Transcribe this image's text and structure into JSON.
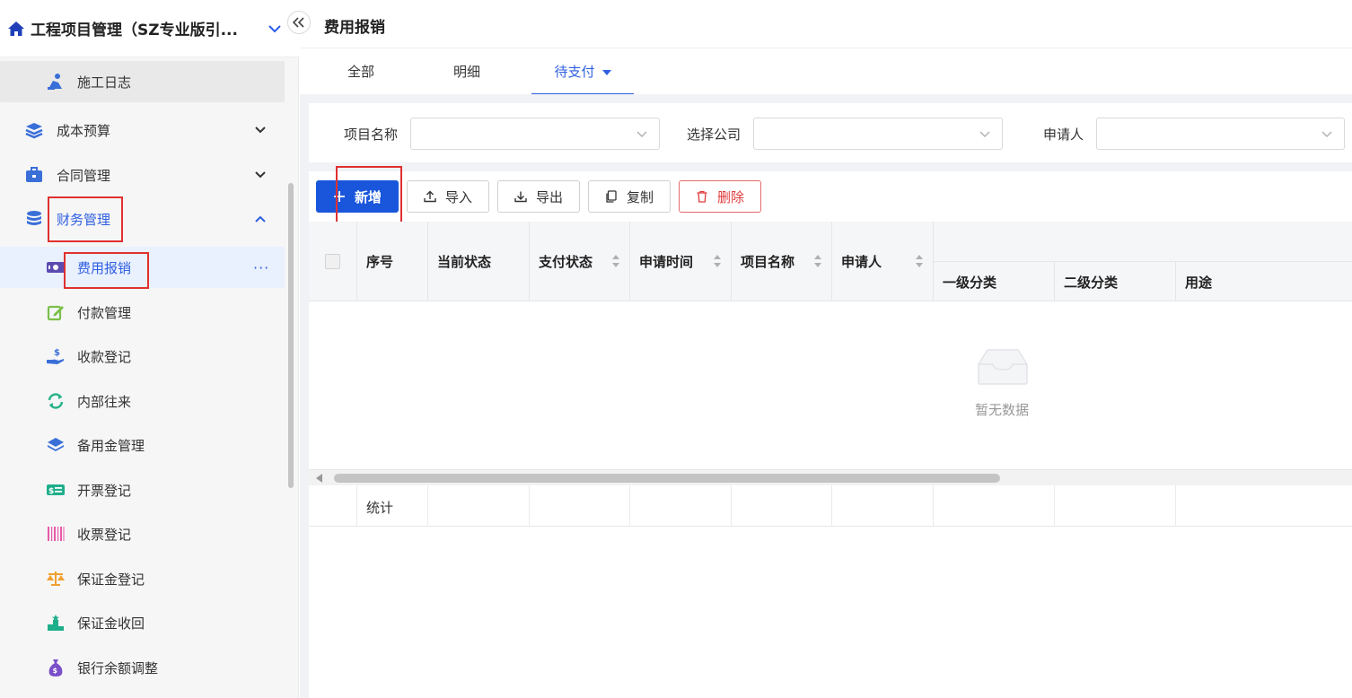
{
  "app": {
    "title": "工程项目管理（SZ专业版引..."
  },
  "page": {
    "title": "费用报销"
  },
  "sidebar": {
    "items": [
      {
        "label": "施工日志",
        "icon": "worker-icon",
        "level": "sub"
      },
      {
        "label": "成本预算",
        "icon": "layers-icon",
        "level": "top"
      },
      {
        "label": "合同管理",
        "icon": "briefcase-icon",
        "level": "top"
      },
      {
        "label": "财务管理",
        "icon": "coins-icon",
        "level": "top"
      },
      {
        "label": "费用报销",
        "icon": "banknote-icon",
        "level": "sub"
      },
      {
        "label": "付款管理",
        "icon": "edit-icon",
        "level": "sub"
      },
      {
        "label": "收款登记",
        "icon": "hand-dollar-icon",
        "level": "sub"
      },
      {
        "label": "内部往来",
        "icon": "refresh-icon",
        "level": "sub"
      },
      {
        "label": "备用金管理",
        "icon": "stack-icon",
        "level": "sub"
      },
      {
        "label": "开票登记",
        "icon": "cash-icon",
        "level": "sub"
      },
      {
        "label": "收票登记",
        "icon": "barcode-icon",
        "level": "sub"
      },
      {
        "label": "保证金登记",
        "icon": "scale-icon",
        "level": "sub"
      },
      {
        "label": "保证金收回",
        "icon": "podium-icon",
        "level": "sub"
      },
      {
        "label": "银行余额调整",
        "icon": "money-bag-icon",
        "level": "sub"
      }
    ],
    "more": "···"
  },
  "tabs": [
    {
      "label": "全部"
    },
    {
      "label": "明细"
    },
    {
      "label": "待支付"
    }
  ],
  "filters": {
    "project": {
      "label": "项目名称",
      "value": ""
    },
    "company": {
      "label": "选择公司",
      "value": ""
    },
    "applicant": {
      "label": "申请人",
      "value": ""
    }
  },
  "toolbar": {
    "add": "新增",
    "import": "导入",
    "export": "导出",
    "copy": "复制",
    "delete": "删除"
  },
  "table": {
    "columns": [
      "序号",
      "当前状态",
      "支付状态",
      "申请时间",
      "项目名称",
      "申请人"
    ],
    "sub_columns": [
      "一级分类",
      "二级分类",
      "用途"
    ],
    "empty_text": "暂无数据",
    "footer_label": "统计"
  },
  "colors": {
    "accent": "#2f5fe0",
    "primary_button": "#1a56db",
    "highlight_box": "#e03030"
  }
}
